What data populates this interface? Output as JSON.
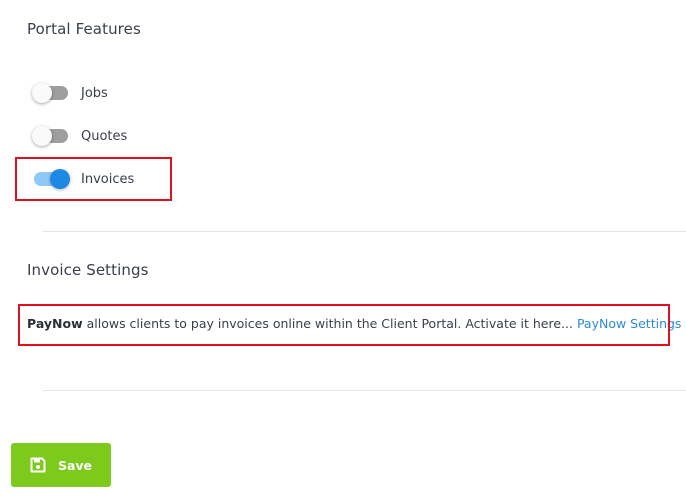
{
  "portal_features": {
    "title": "Portal Features",
    "toggles": [
      {
        "label": "Jobs",
        "enabled": false
      },
      {
        "label": "Quotes",
        "enabled": false
      },
      {
        "label": "Invoices",
        "enabled": true
      }
    ]
  },
  "invoice_settings": {
    "title": "Invoice Settings",
    "paynow_bold": "PayNow",
    "paynow_text": " allows clients to pay invoices online within the Client Portal. Activate it here... ",
    "paynow_link": "PayNow Settings"
  },
  "actions": {
    "save_label": "Save",
    "save_icon": "floppy-disk-icon"
  },
  "colors": {
    "toggle_on": "#1e88e5",
    "highlight": "#e0101e",
    "save_button": "#7dc91c",
    "link": "#2d8ad8"
  }
}
